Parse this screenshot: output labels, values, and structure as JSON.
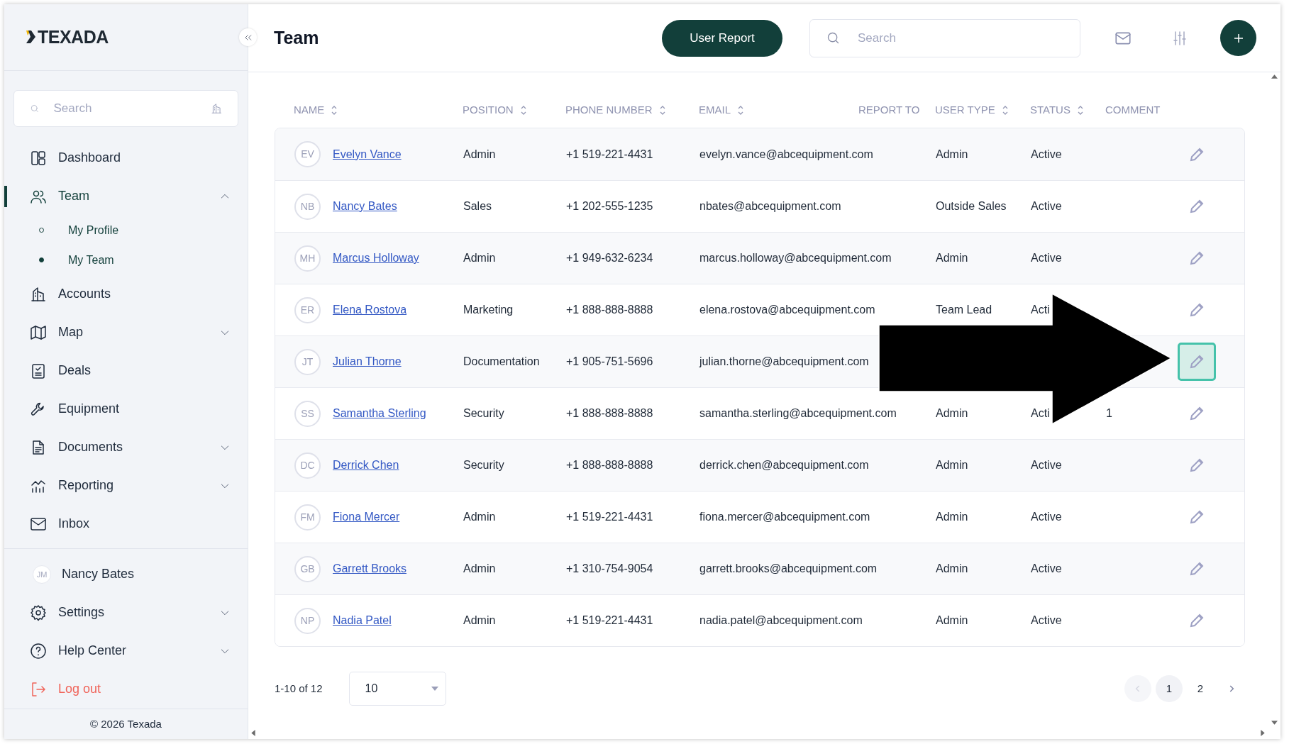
{
  "sidebar": {
    "logo": "TEXADA",
    "search": {
      "placeholder": "Search"
    },
    "items": [
      {
        "label": "Dashboard",
        "kind": "link",
        "selected": false
      },
      {
        "label": "Team",
        "kind": "group",
        "selected": true,
        "expanded": true,
        "children": [
          {
            "label": "My Profile",
            "selected": false
          },
          {
            "label": "My Team",
            "selected": true
          }
        ]
      },
      {
        "label": "Accounts",
        "kind": "link",
        "selected": false
      },
      {
        "label": "Map",
        "kind": "group",
        "selected": false,
        "expanded": false
      },
      {
        "label": "Deals",
        "kind": "link",
        "selected": false
      },
      {
        "label": "Equipment",
        "kind": "link",
        "selected": false
      },
      {
        "label": "Documents",
        "kind": "group",
        "selected": false,
        "expanded": false
      },
      {
        "label": "Reporting",
        "kind": "group",
        "selected": false,
        "expanded": false
      },
      {
        "label": "Inbox",
        "kind": "link",
        "selected": false
      }
    ],
    "account": {
      "initials": "JM",
      "name": "Nancy Bates"
    },
    "bottom_items": [
      {
        "label": "Settings",
        "kind": "group",
        "selected": false,
        "expanded": false
      },
      {
        "label": "Help Center",
        "kind": "group",
        "selected": false,
        "expanded": false
      },
      {
        "label": "Log out",
        "kind": "logout",
        "selected": false
      }
    ],
    "footer": "© 2026 Texada"
  },
  "header": {
    "title": "Team",
    "report_button": "User Report",
    "search": {
      "placeholder": "Search"
    }
  },
  "table": {
    "columns": [
      {
        "label": "NAME",
        "sortable": true
      },
      {
        "label": "POSITION",
        "sortable": true
      },
      {
        "label": "PHONE NUMBER",
        "sortable": true
      },
      {
        "label": "EMAIL",
        "sortable": true
      },
      {
        "label": "REPORT TO",
        "sortable": false
      },
      {
        "label": "USER TYPE",
        "sortable": true
      },
      {
        "label": "STATUS",
        "sortable": true
      },
      {
        "label": "COMMENT",
        "sortable": false
      }
    ],
    "rows": [
      {
        "initials": "EV",
        "name": "Evelyn Vance",
        "position": "Admin",
        "phone": "+1 519-221-4431",
        "email": "evelyn.vance@abcequipment.com",
        "user_type": "Admin",
        "status": "Active",
        "highlighted": false
      },
      {
        "initials": "NB",
        "name": "Nancy Bates",
        "position": "Sales",
        "phone": "+1 202-555-1235",
        "email": "nbates@abcequipment.com",
        "user_type": "Outside Sales",
        "status": "Active",
        "highlighted": false
      },
      {
        "initials": "MH",
        "name": "Marcus Holloway",
        "position": "Admin",
        "phone": "+1 949-632-6234",
        "email": "marcus.holloway@abcequipment.com",
        "user_type": "Admin",
        "status": "Active",
        "highlighted": false
      },
      {
        "initials": "ER",
        "name": "Elena Rostova",
        "position": "Marketing",
        "phone": "+1 888-888-8888",
        "email": "elena.rostova@abcequipment.com",
        "user_type": "Team Lead",
        "status": "Acti",
        "highlighted": false
      },
      {
        "initials": "JT",
        "name": "Julian Thorne",
        "position": "Documentation",
        "phone": "+1 905-751-5696",
        "email": "julian.thorne@abcequipment.com",
        "highlighted": true
      },
      {
        "initials": "SS",
        "name": "Samantha Sterling",
        "position": "Security",
        "phone": "+1 888-888-8888",
        "email": "samantha.sterling@abcequipment.com",
        "user_type": "Admin",
        "status": "Acti",
        "comment": "1",
        "highlighted": false
      },
      {
        "initials": "DC",
        "name": "Derrick Chen",
        "position": "Security",
        "phone": "+1 888-888-8888",
        "email": "derrick.chen@abcequipment.com",
        "user_type": "Admin",
        "status": "Active",
        "highlighted": false
      },
      {
        "initials": "FM",
        "name": "Fiona Mercer",
        "position": "Admin",
        "phone": "+1 519-221-4431",
        "email": "fiona.mercer@abcequipment.com",
        "user_type": "Admin",
        "status": "Active",
        "highlighted": false
      },
      {
        "initials": "GB",
        "name": "Garrett Brooks",
        "position": "Admin",
        "phone": "+1 310-754-9054",
        "email": "garrett.brooks@abcequipment.com",
        "user_type": "Admin",
        "status": "Active",
        "highlighted": false
      },
      {
        "initials": "NP",
        "name": "Nadia Patel",
        "position": "Admin",
        "phone": "+1 519-221-4431",
        "email": "nadia.patel@abcequipment.com",
        "user_type": "Admin",
        "status": "Active",
        "highlighted": false
      }
    ]
  },
  "pagination": {
    "range": "1-10 of 12",
    "page_size": "10",
    "prev_disabled": true,
    "next_disabled": false,
    "pages": [
      {
        "label": "1",
        "selected": true
      },
      {
        "label": "2",
        "selected": false
      }
    ]
  }
}
